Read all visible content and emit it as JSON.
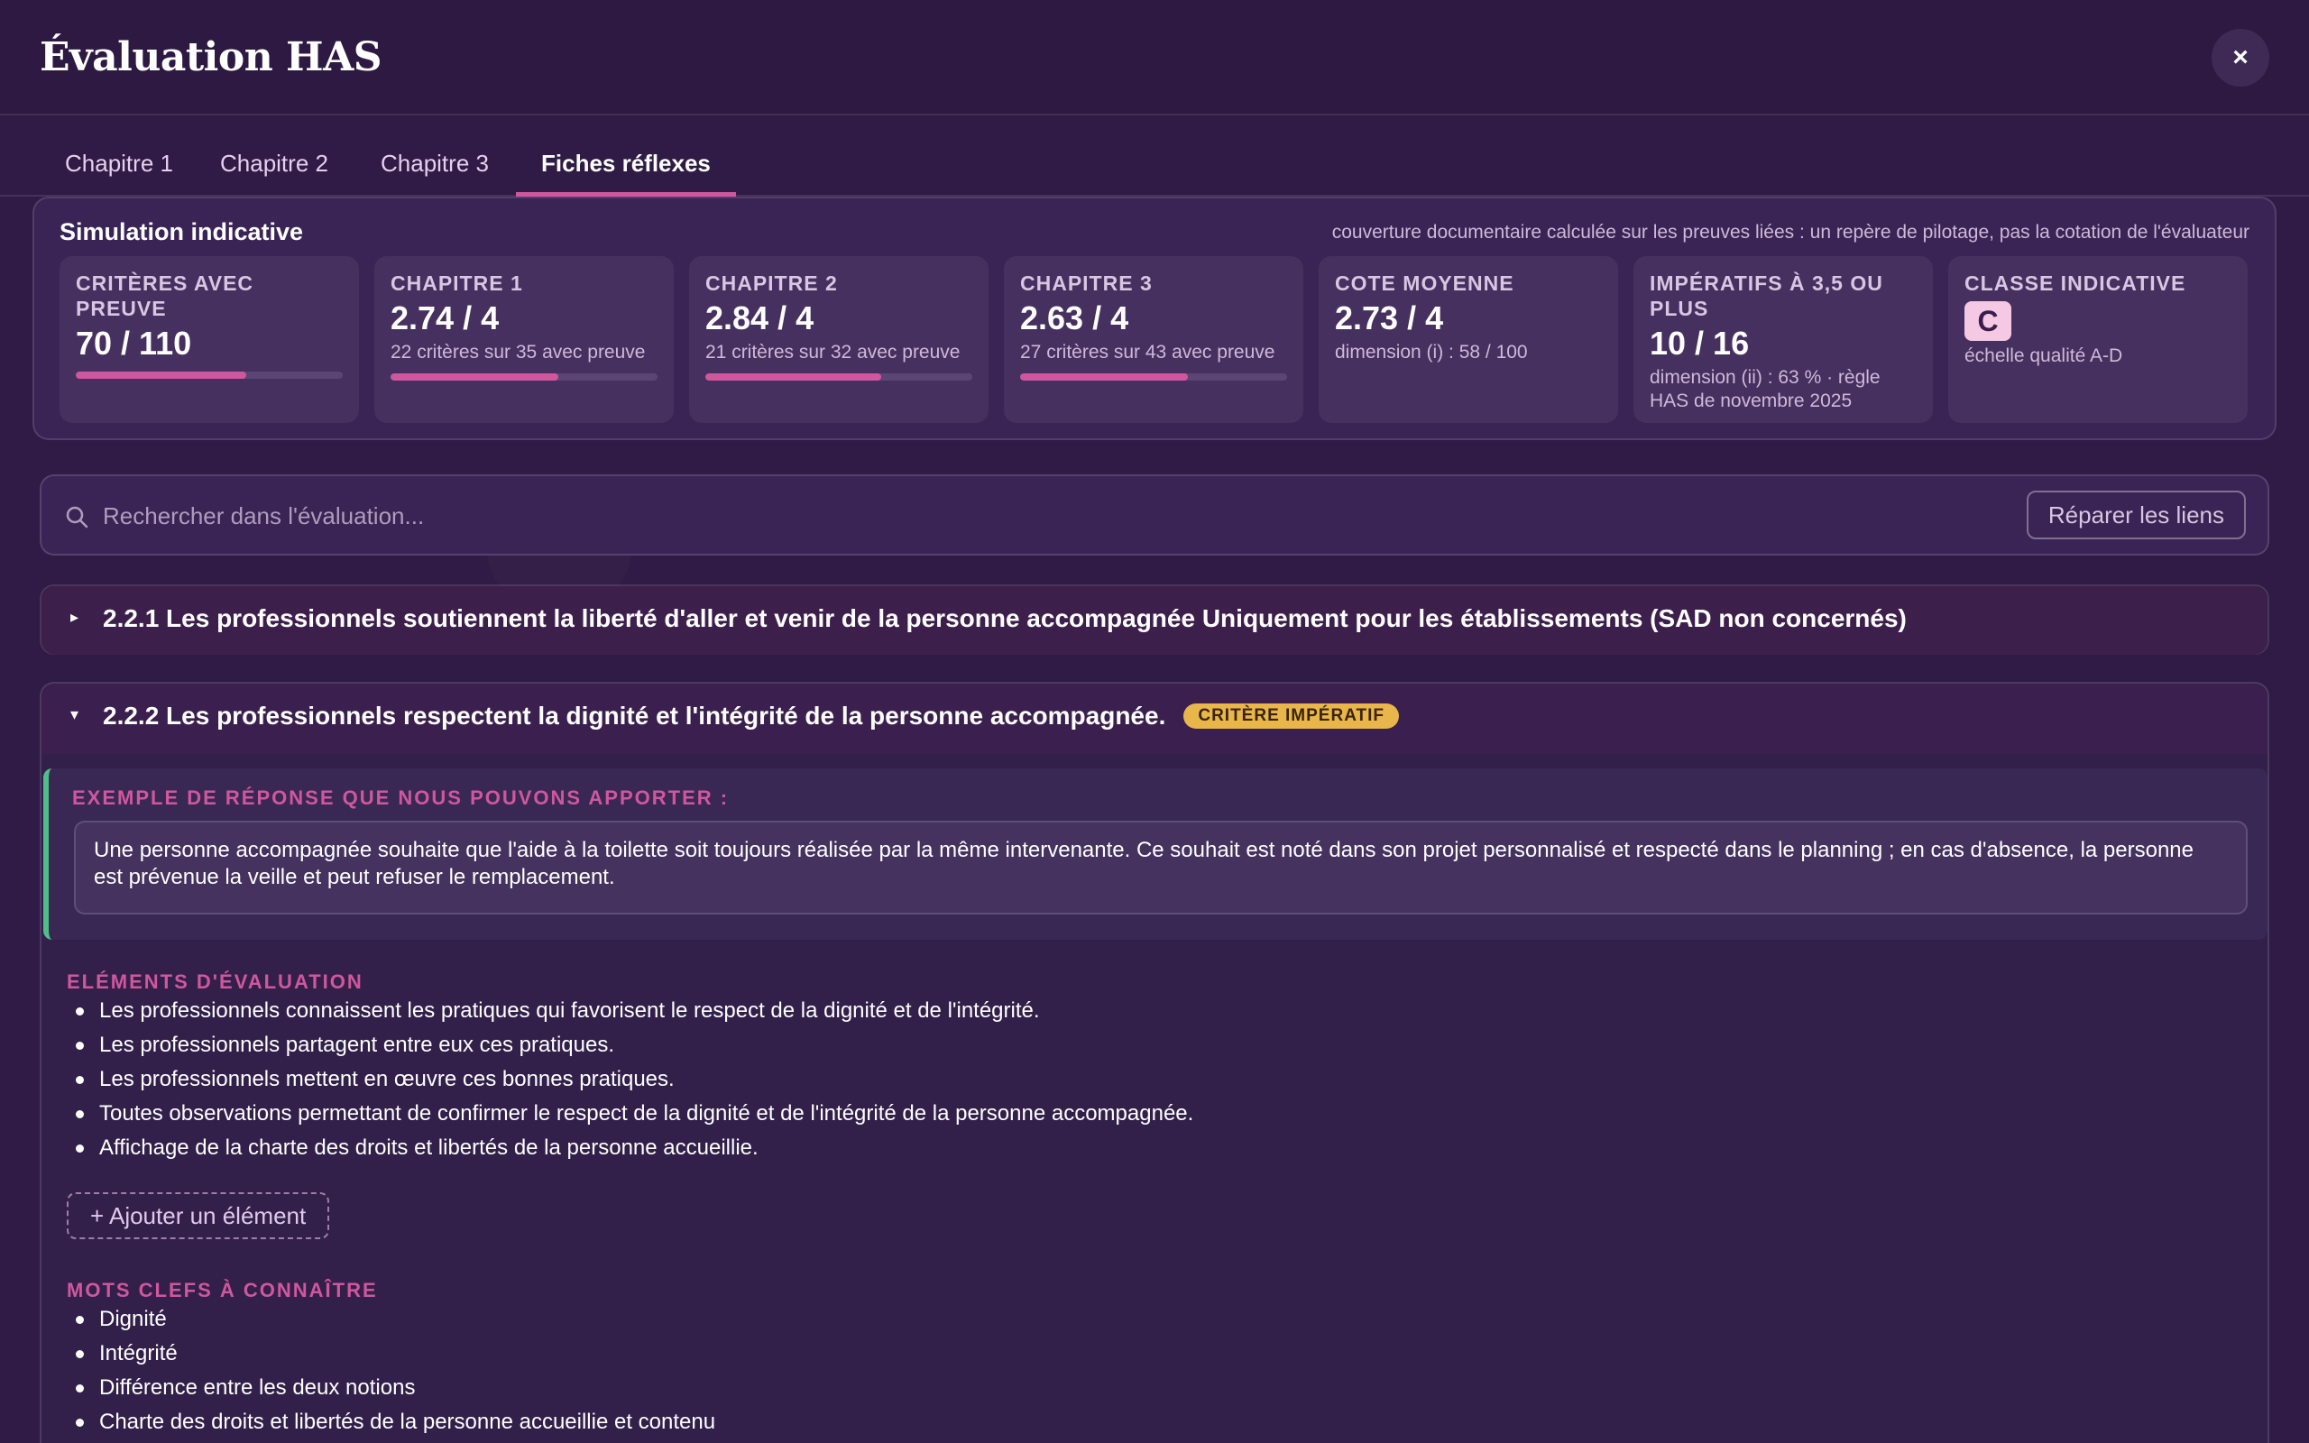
{
  "header": {
    "title": "Évaluation HAS",
    "close_label": "×"
  },
  "tabs": [
    {
      "label": "Chapitre 1"
    },
    {
      "label": "Chapitre 2"
    },
    {
      "label": "Chapitre 3"
    },
    {
      "label": "Fiches réflexes",
      "active": true
    }
  ],
  "simulation": {
    "title": "Simulation indicative",
    "note": "couverture documentaire calculée sur les preuves liées : un repère de pilotage, pas la cotation de l'évaluateur",
    "cards": [
      {
        "label": "Critères avec preuve",
        "value": "70 / 110",
        "sub": "",
        "progress": 0.64
      },
      {
        "label": "Chapitre 1",
        "value": "2.74 / 4",
        "sub": "22 critères sur 35 avec preuve",
        "progress": 0.63
      },
      {
        "label": "Chapitre 2",
        "value": "2.84 / 4",
        "sub": "21 critères sur 32 avec preuve",
        "progress": 0.66
      },
      {
        "label": "Chapitre 3",
        "value": "2.63 / 4",
        "sub": "27 critères sur 43 avec preuve",
        "progress": 0.63
      },
      {
        "label": "Cote moyenne",
        "value": "2.73 / 4",
        "sub": "dimension (i) : 58 / 100"
      },
      {
        "label": "Impératifs à 3,5 ou plus",
        "value": "10 / 16",
        "sub": "dimension (ii) : 63 % · règle HAS de novembre 2025"
      },
      {
        "label": "Classe indicative",
        "value": "C",
        "sub": "échelle qualité A-D"
      }
    ]
  },
  "search": {
    "placeholder": "Rechercher dans l'évaluation...",
    "repair_label": "Réparer les liens"
  },
  "criteria": [
    {
      "title": "2.2.1 Les professionnels soutiennent la liberté d'aller et venir de la personne accompagnée Uniquement pour les établissements (SAD non concernés)",
      "arrow": "▸"
    },
    {
      "title": "2.2.2 Les professionnels respectent la dignité et l'intégrité de la personne accompagnée.",
      "arrow": "▾",
      "badge": "CRITÈRE IMPÉRATIF",
      "example_label": "Exemple de réponse que nous pouvons apporter :",
      "example_text": "Une personne accompagnée souhaite que l'aide à la toilette soit toujours réalisée par la même intervenante. Ce souhait est noté dans son projet personnalisé et respecté dans le planning ; en cas d'absence, la personne est prévenue la veille et peut refuser le remplacement.",
      "elements_label": "Eléments d'évaluation",
      "elements": [
        "Les professionnels connaissent les pratiques qui favorisent le respect de la dignité et de l'intégrité.",
        "Les professionnels partagent entre eux ces pratiques.",
        "Les professionnels mettent en œuvre ces bonnes pratiques.",
        "Toutes observations permettant de confirmer le respect de la dignité et de l'intégrité de la personne accompagnée.",
        "Affichage de la charte des droits et libertés de la personne accueillie."
      ],
      "add_label": "+ Ajouter un élément",
      "keywords_label": "Mots clefs à connaître",
      "keywords": [
        "Dignité",
        "Intégrité",
        "Différence entre les deux notions",
        "Charte des droits et libertés de la personne accueillie et contenu"
      ]
    }
  ],
  "colors": {
    "accent": "#d0579e",
    "badge": "#e8b64b",
    "example_border": "#4fbf8a"
  }
}
